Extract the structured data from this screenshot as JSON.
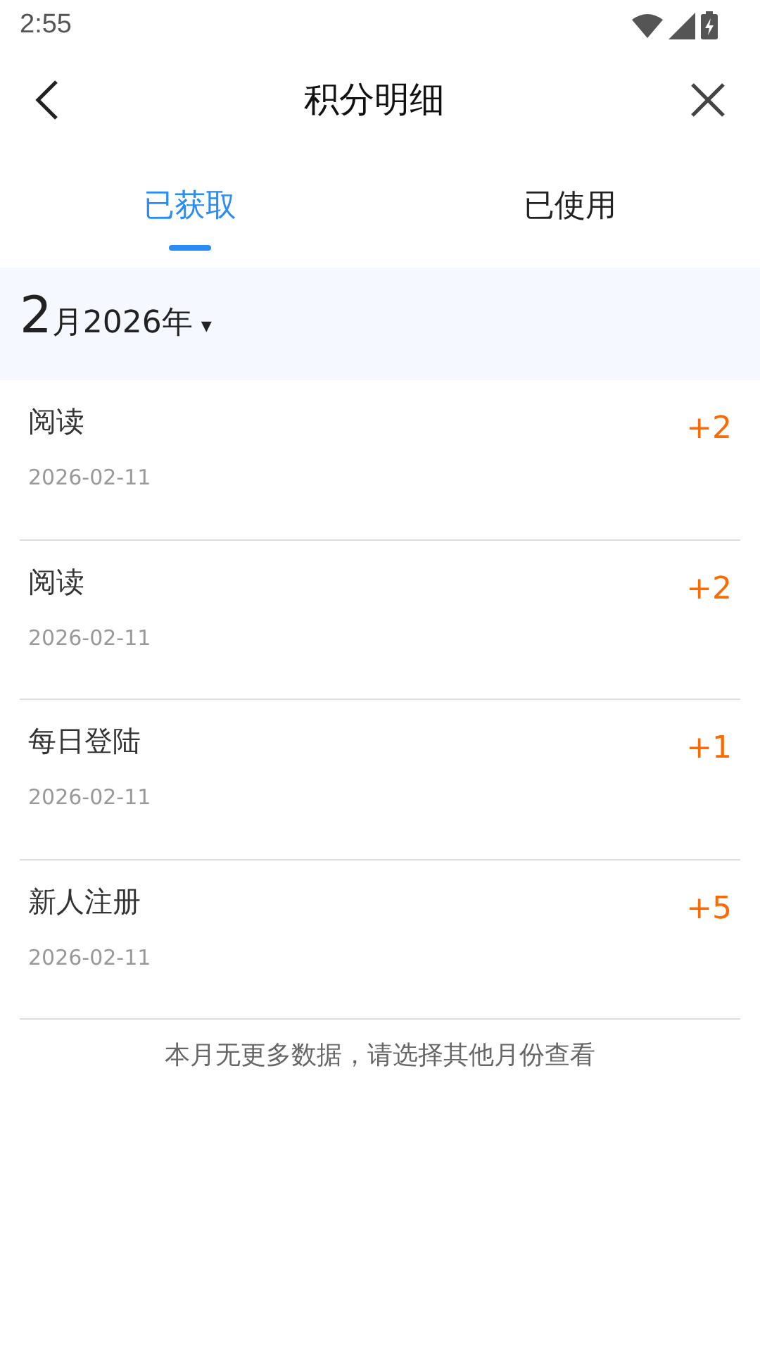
{
  "status_bar": {
    "time": "2:55"
  },
  "header": {
    "title": "积分明细"
  },
  "tabs": [
    {
      "label": "已获取",
      "selected": true
    },
    {
      "label": "已使用",
      "selected": false
    }
  ],
  "month_picker": {
    "month": "2",
    "suffix": "月2026年",
    "caret": "▾"
  },
  "records": [
    {
      "title": "阅读",
      "date": "2026-02-11",
      "points": "+2"
    },
    {
      "title": "阅读",
      "date": "2026-02-11",
      "points": "+2"
    },
    {
      "title": "每日登陆",
      "date": "2026-02-11",
      "points": "+1"
    },
    {
      "title": "新人注册",
      "date": "2026-02-11",
      "points": "+5"
    }
  ],
  "footer_note": "本月无更多数据，请选择其他月份查看"
}
